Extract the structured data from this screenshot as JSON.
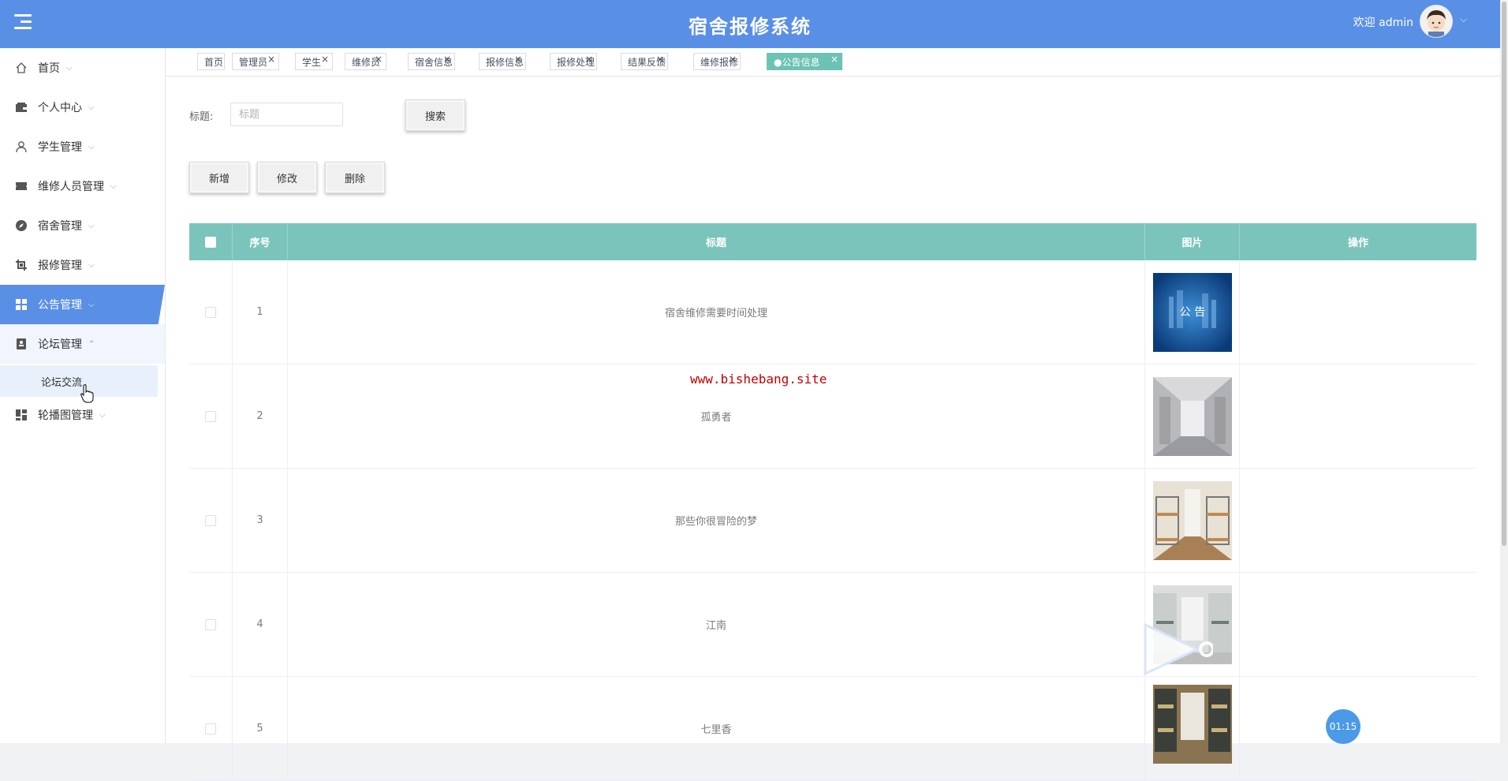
{
  "header": {
    "title": "宿舍报修系统",
    "welcome": "欢迎 admin",
    "accent": "#5a8fe6"
  },
  "sidebar": {
    "items": [
      {
        "label": "首页",
        "icon": "home-icon"
      },
      {
        "label": "个人中心",
        "icon": "wallet-icon"
      },
      {
        "label": "学生管理",
        "icon": "user-icon"
      },
      {
        "label": "维修人员管理",
        "icon": "ticket-icon"
      },
      {
        "label": "宿舍管理",
        "icon": "compass-icon"
      },
      {
        "label": "报修管理",
        "icon": "crop-icon"
      },
      {
        "label": "公告管理",
        "icon": "grid-icon",
        "active": true
      },
      {
        "label": "论坛管理",
        "icon": "notebook-icon",
        "expanded": true
      },
      {
        "label": "轮播图管理",
        "icon": "dashboard-icon"
      }
    ],
    "sub_item": "论坛交流"
  },
  "tabs": [
    {
      "label": "首页",
      "closable": false
    },
    {
      "label": "管理员",
      "closable": true
    },
    {
      "label": "学生",
      "closable": true
    },
    {
      "label": "维修员",
      "closable": true
    },
    {
      "label": "宿舍信息",
      "closable": true
    },
    {
      "label": "报修信息",
      "closable": true
    },
    {
      "label": "报修处理",
      "closable": true
    },
    {
      "label": "结果反馈",
      "closable": true
    },
    {
      "label": "维修报修",
      "closable": true
    },
    {
      "label": "●公告信息",
      "closable": true,
      "active": true
    }
  ],
  "search": {
    "label": "标题:",
    "placeholder": "标题",
    "button": "搜索"
  },
  "actions": {
    "add": "新增",
    "edit": "修改",
    "delete": "删除"
  },
  "table": {
    "headers": {
      "index": "序号",
      "title": "标题",
      "image": "图片",
      "ops": "操作"
    },
    "header_color": "#7bc4bb",
    "rows": [
      {
        "index": "1",
        "title": "宿舍维修需要时间处理",
        "image": "notice-banner-image"
      },
      {
        "index": "2",
        "title": "孤勇者",
        "image": "dorm-hallway-image"
      },
      {
        "index": "3",
        "title": "那些你很冒险的梦",
        "image": "dorm-bunk-image"
      },
      {
        "index": "4",
        "title": "江南",
        "image": "dorm-room-image"
      },
      {
        "index": "5",
        "title": "七里香",
        "image": "dorm-corridor-image"
      }
    ]
  },
  "overlay": {
    "watermark": "www.bishebang.site",
    "timer": "01:15"
  }
}
